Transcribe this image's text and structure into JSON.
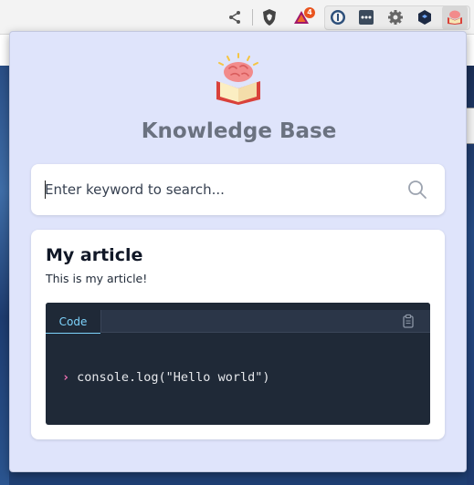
{
  "extension": {
    "title": "Knowledge Base",
    "search": {
      "placeholder": "Enter keyword to search...",
      "value": ""
    },
    "article": {
      "title": "My article",
      "body": "This is my article!",
      "code": {
        "tab_label": "Code",
        "prompt_symbol": "›",
        "line": "console.log(\"Hello world\")"
      }
    }
  },
  "browser": {
    "badge_count": "4",
    "toolbar_icons": [
      "share-icon",
      "brave-shield-icon",
      "brave-rewards-icon",
      "onepassword-icon",
      "more-dots-icon",
      "gear-extension-icon",
      "cube-extension-icon",
      "knowledge-base-extension-icon"
    ]
  },
  "colors": {
    "popup_bg": "#dfe4fb",
    "title": "#6b7280",
    "code_bg": "#1f2937",
    "code_tab": "#7dd3fc",
    "prompt": "#f472b6"
  }
}
